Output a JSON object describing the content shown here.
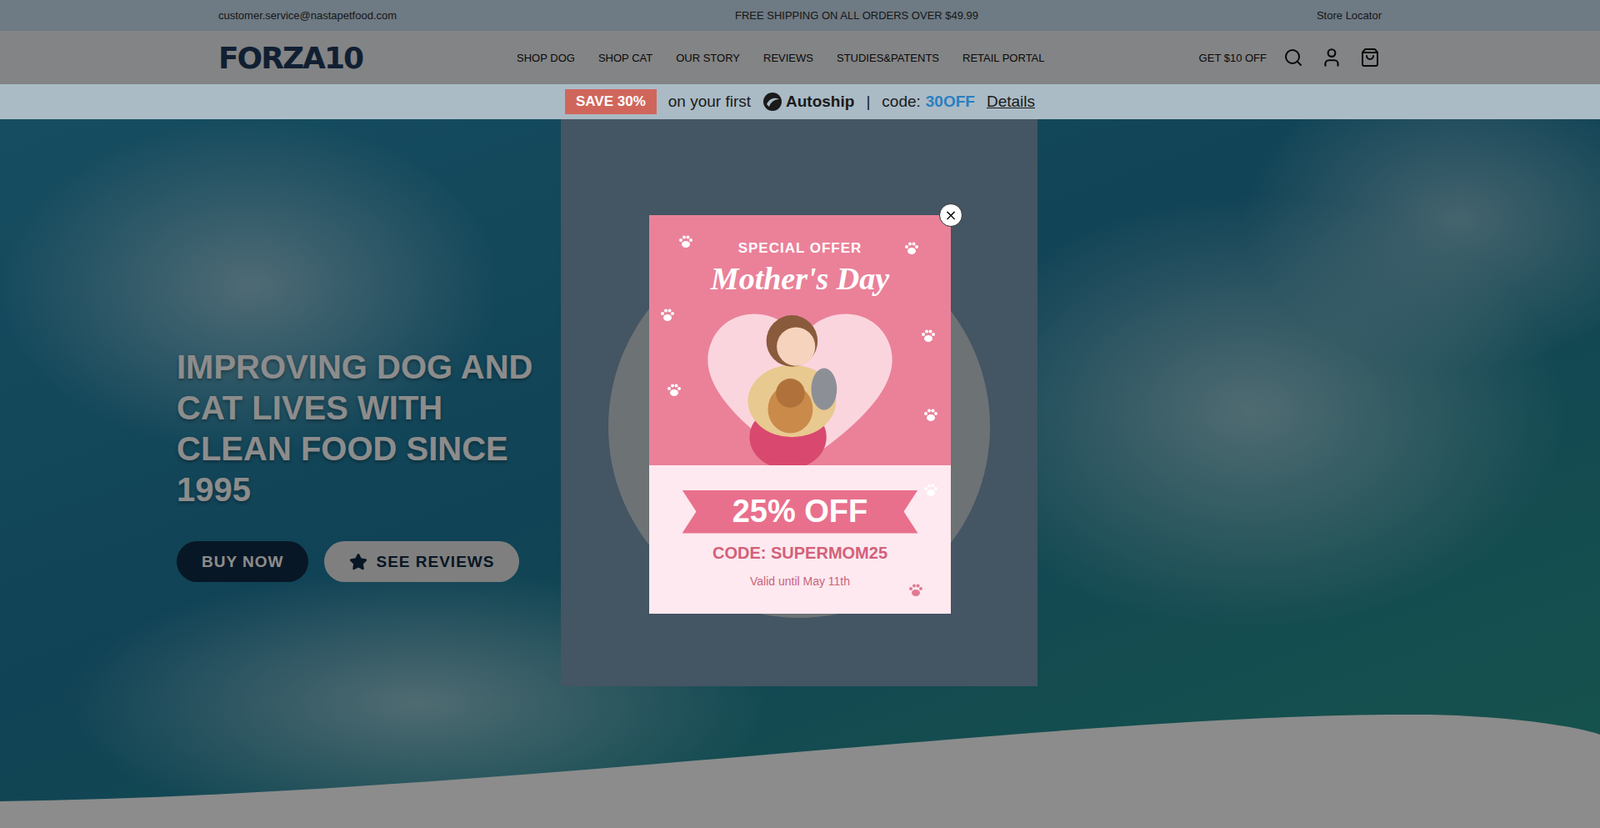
{
  "top_bar": {
    "email": "customer.service@nastapetfood.com",
    "shipping": "FREE SHIPPING ON ALL ORDERS OVER $49.99",
    "store_locator": "Store Locator"
  },
  "nav": {
    "logo": "FORZA10",
    "items": [
      "SHOP DOG",
      "SHOP CAT",
      "OUR STORY",
      "REVIEWS",
      "STUDIES&PATENTS",
      "RETAIL PORTAL"
    ],
    "offer": "GET $10 OFF"
  },
  "promo": {
    "badge": "SAVE 30%",
    "text": "on your first",
    "brand": "Autoship",
    "separator": "|",
    "code_label": "code:",
    "code": "30OFF",
    "details": "Details"
  },
  "hero": {
    "heading": "IMPROVING DOG AND CAT LIVES WITH CLEAN FOOD SINCE 1995",
    "buttons": [
      {
        "label": "BUY NOW",
        "kind": "primary"
      },
      {
        "label": "SEE REVIEWS",
        "kind": "secondary"
      }
    ]
  },
  "modal": {
    "close": "×",
    "eyebrow": "SPECIAL OFFER",
    "title": "Mother's Day",
    "discount": "25% OFF",
    "code": "CODE: SUPERMOM25",
    "validity": "Valid until May 11th"
  }
}
